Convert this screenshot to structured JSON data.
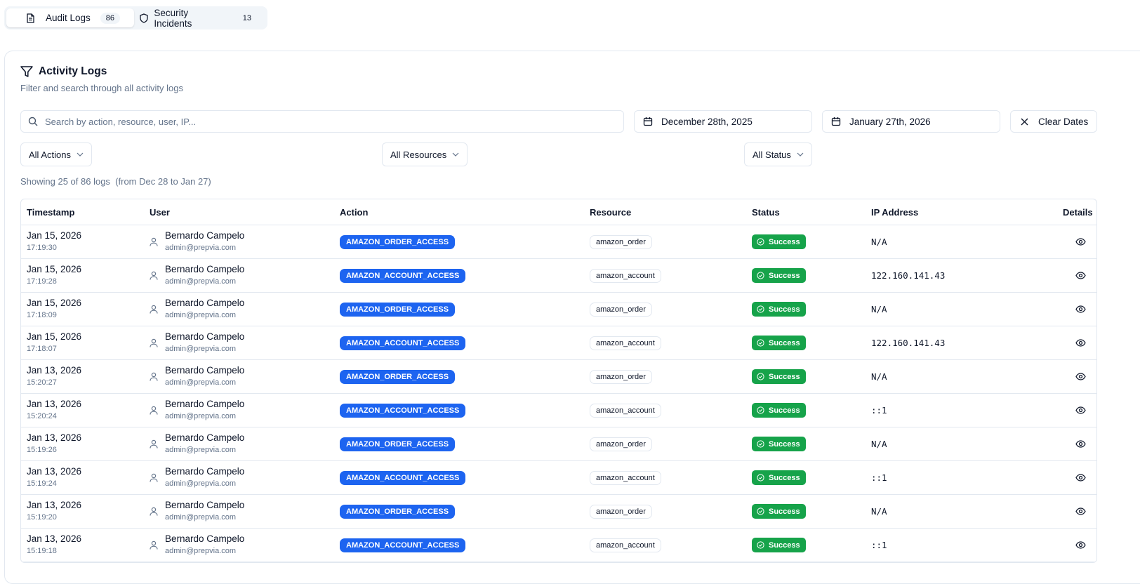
{
  "tabs": [
    {
      "label": "Audit Logs",
      "count": "86",
      "icon": "file-text-icon",
      "active": true
    },
    {
      "label": "Security Incidents",
      "count": "13",
      "icon": "shield-icon",
      "active": false
    }
  ],
  "card": {
    "title": "Activity Logs",
    "subtitle": "Filter and search through all activity logs"
  },
  "filters": {
    "search_placeholder": "Search by action, resource, user, IP...",
    "start_date": "December 28th, 2025",
    "end_date": "January 27th, 2026",
    "clear_label": "Clear Dates",
    "action_select": "All Actions",
    "resource_select": "All Resources",
    "status_select": "All Status"
  },
  "summary": {
    "text": "Showing 25 of 86 logs",
    "range": "(from Dec 28 to Jan 27)"
  },
  "table": {
    "headers": {
      "timestamp": "Timestamp",
      "user": "User",
      "action": "Action",
      "resource": "Resource",
      "status": "Status",
      "ip": "IP Address",
      "details": "Details"
    },
    "rows": [
      {
        "date": "Jan 15, 2026",
        "time": "17:19:30",
        "user": "Bernardo Campelo",
        "email": "admin@prepvia.com",
        "action": "AMAZON_ORDER_ACCESS",
        "resource": "amazon_order",
        "status": "Success",
        "ip": "N/A"
      },
      {
        "date": "Jan 15, 2026",
        "time": "17:19:28",
        "user": "Bernardo Campelo",
        "email": "admin@prepvia.com",
        "action": "AMAZON_ACCOUNT_ACCESS",
        "resource": "amazon_account",
        "status": "Success",
        "ip": "122.160.141.43"
      },
      {
        "date": "Jan 15, 2026",
        "time": "17:18:09",
        "user": "Bernardo Campelo",
        "email": "admin@prepvia.com",
        "action": "AMAZON_ORDER_ACCESS",
        "resource": "amazon_order",
        "status": "Success",
        "ip": "N/A"
      },
      {
        "date": "Jan 15, 2026",
        "time": "17:18:07",
        "user": "Bernardo Campelo",
        "email": "admin@prepvia.com",
        "action": "AMAZON_ACCOUNT_ACCESS",
        "resource": "amazon_account",
        "status": "Success",
        "ip": "122.160.141.43"
      },
      {
        "date": "Jan 13, 2026",
        "time": "15:20:27",
        "user": "Bernardo Campelo",
        "email": "admin@prepvia.com",
        "action": "AMAZON_ORDER_ACCESS",
        "resource": "amazon_order",
        "status": "Success",
        "ip": "N/A"
      },
      {
        "date": "Jan 13, 2026",
        "time": "15:20:24",
        "user": "Bernardo Campelo",
        "email": "admin@prepvia.com",
        "action": "AMAZON_ACCOUNT_ACCESS",
        "resource": "amazon_account",
        "status": "Success",
        "ip": "::1"
      },
      {
        "date": "Jan 13, 2026",
        "time": "15:19:26",
        "user": "Bernardo Campelo",
        "email": "admin@prepvia.com",
        "action": "AMAZON_ORDER_ACCESS",
        "resource": "amazon_order",
        "status": "Success",
        "ip": "N/A"
      },
      {
        "date": "Jan 13, 2026",
        "time": "15:19:24",
        "user": "Bernardo Campelo",
        "email": "admin@prepvia.com",
        "action": "AMAZON_ACCOUNT_ACCESS",
        "resource": "amazon_account",
        "status": "Success",
        "ip": "::1"
      },
      {
        "date": "Jan 13, 2026",
        "time": "15:19:20",
        "user": "Bernardo Campelo",
        "email": "admin@prepvia.com",
        "action": "AMAZON_ORDER_ACCESS",
        "resource": "amazon_order",
        "status": "Success",
        "ip": "N/A"
      },
      {
        "date": "Jan 13, 2026",
        "time": "15:19:18",
        "user": "Bernardo Campelo",
        "email": "admin@prepvia.com",
        "action": "AMAZON_ACCOUNT_ACCESS",
        "resource": "amazon_account",
        "status": "Success",
        "ip": "::1"
      }
    ]
  },
  "colors": {
    "action_badge": "#1d64f0",
    "status_success": "#16a34a",
    "muted_text": "#64748b",
    "border": "#e2e8f0"
  }
}
